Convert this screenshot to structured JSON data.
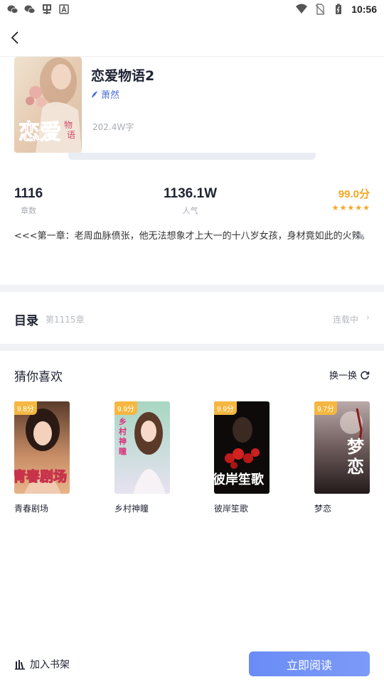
{
  "status_bar": {
    "time": "10:56",
    "left_icons": [
      "wechat-icon",
      "wechat-icon",
      "app-icon",
      "text-icon"
    ],
    "right_icons": [
      "wifi-icon",
      "no-sim-icon",
      "battery-icon"
    ]
  },
  "book": {
    "title": "恋爱物语2",
    "author": "萧然",
    "word_count": "202.4W字",
    "cover_text": "恋爱",
    "cover_subtext": "物语"
  },
  "stats": {
    "chapters_value": "1116",
    "chapters_label": "章数",
    "popularity_value": "1136.1W",
    "popularity_label": "人气",
    "score": "99.0分",
    "stars": 5
  },
  "intro": {
    "text": "<<<第一章：老周血脉偾张，他无法想象才上大一的十八岁女孩，身材竟如此的火辣。"
  },
  "catalog": {
    "title": "目录",
    "chapter": "第1115章",
    "status": "连载中"
  },
  "recommend": {
    "title": "猜你喜欢",
    "refresh_label": "换一换",
    "items": [
      {
        "name": "青春剧场",
        "score": "9.8分",
        "cover_text": "青春剧场"
      },
      {
        "name": "乡村神瞳",
        "score": "9.9分",
        "cover_text": "乡村神瞳"
      },
      {
        "name": "彼岸笙歌",
        "score": "9.9分",
        "cover_text": "彼岸笙歌"
      },
      {
        "name": "梦恋",
        "score": "9.7分",
        "cover_text": "梦恋"
      }
    ]
  },
  "bottom": {
    "shelf_label": "加入书架",
    "read_label": "立即阅读"
  },
  "colors": {
    "accent": "#6a8cf5",
    "score": "#f5a623",
    "author": "#4a6fd8"
  }
}
